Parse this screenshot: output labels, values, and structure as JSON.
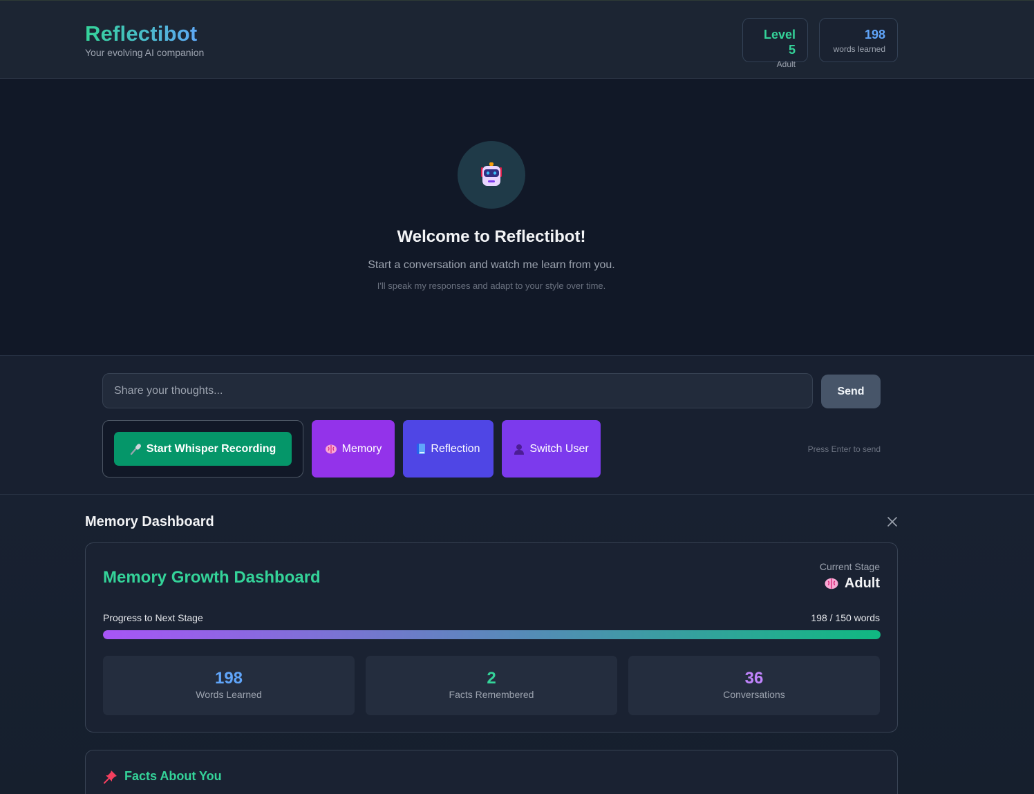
{
  "header": {
    "title": "Reflectibot",
    "subtitle": "Your evolving AI companion",
    "level": {
      "value": "Level 5",
      "label": "Adult"
    },
    "words": {
      "value": "198",
      "label": "words learned"
    }
  },
  "welcome": {
    "avatar_icon": "robot-icon",
    "title": "Welcome to Reflectibot!",
    "subtitle": "Start a conversation and watch me learn from you.",
    "note": "I'll speak my responses and adapt to your style over time."
  },
  "composer": {
    "input_placeholder": "Share your thoughts...",
    "input_value": "",
    "send_label": "Send",
    "record_label": "Start Whisper Recording",
    "memory_label": "Memory",
    "reflection_label": "Reflection",
    "switch_user_label": "Switch User",
    "hint": "Press Enter to send"
  },
  "dashboard": {
    "title": "Memory Dashboard",
    "card_title": "Memory Growth Dashboard",
    "stage_label": "Current Stage",
    "stage_value": "Adult",
    "progress_label": "Progress to Next Stage",
    "progress_value": "198 / 150 words",
    "progress_fraction": 1.0,
    "stats": [
      {
        "value": "198",
        "label": "Words Learned",
        "color": "#60a5fa"
      },
      {
        "value": "2",
        "label": "Facts Remembered",
        "color": "#34d399"
      },
      {
        "value": "36",
        "label": "Conversations",
        "color": "#c084fc"
      }
    ],
    "facts_title": "Facts About You"
  },
  "colors": {
    "accent_green": "#34d399",
    "accent_blue": "#60a5fa",
    "accent_purple": "#c084fc",
    "record_button": "#059669",
    "memory_button": "#9333ea",
    "reflection_button": "#4f46e5",
    "switch_button": "#7c3aed"
  }
}
